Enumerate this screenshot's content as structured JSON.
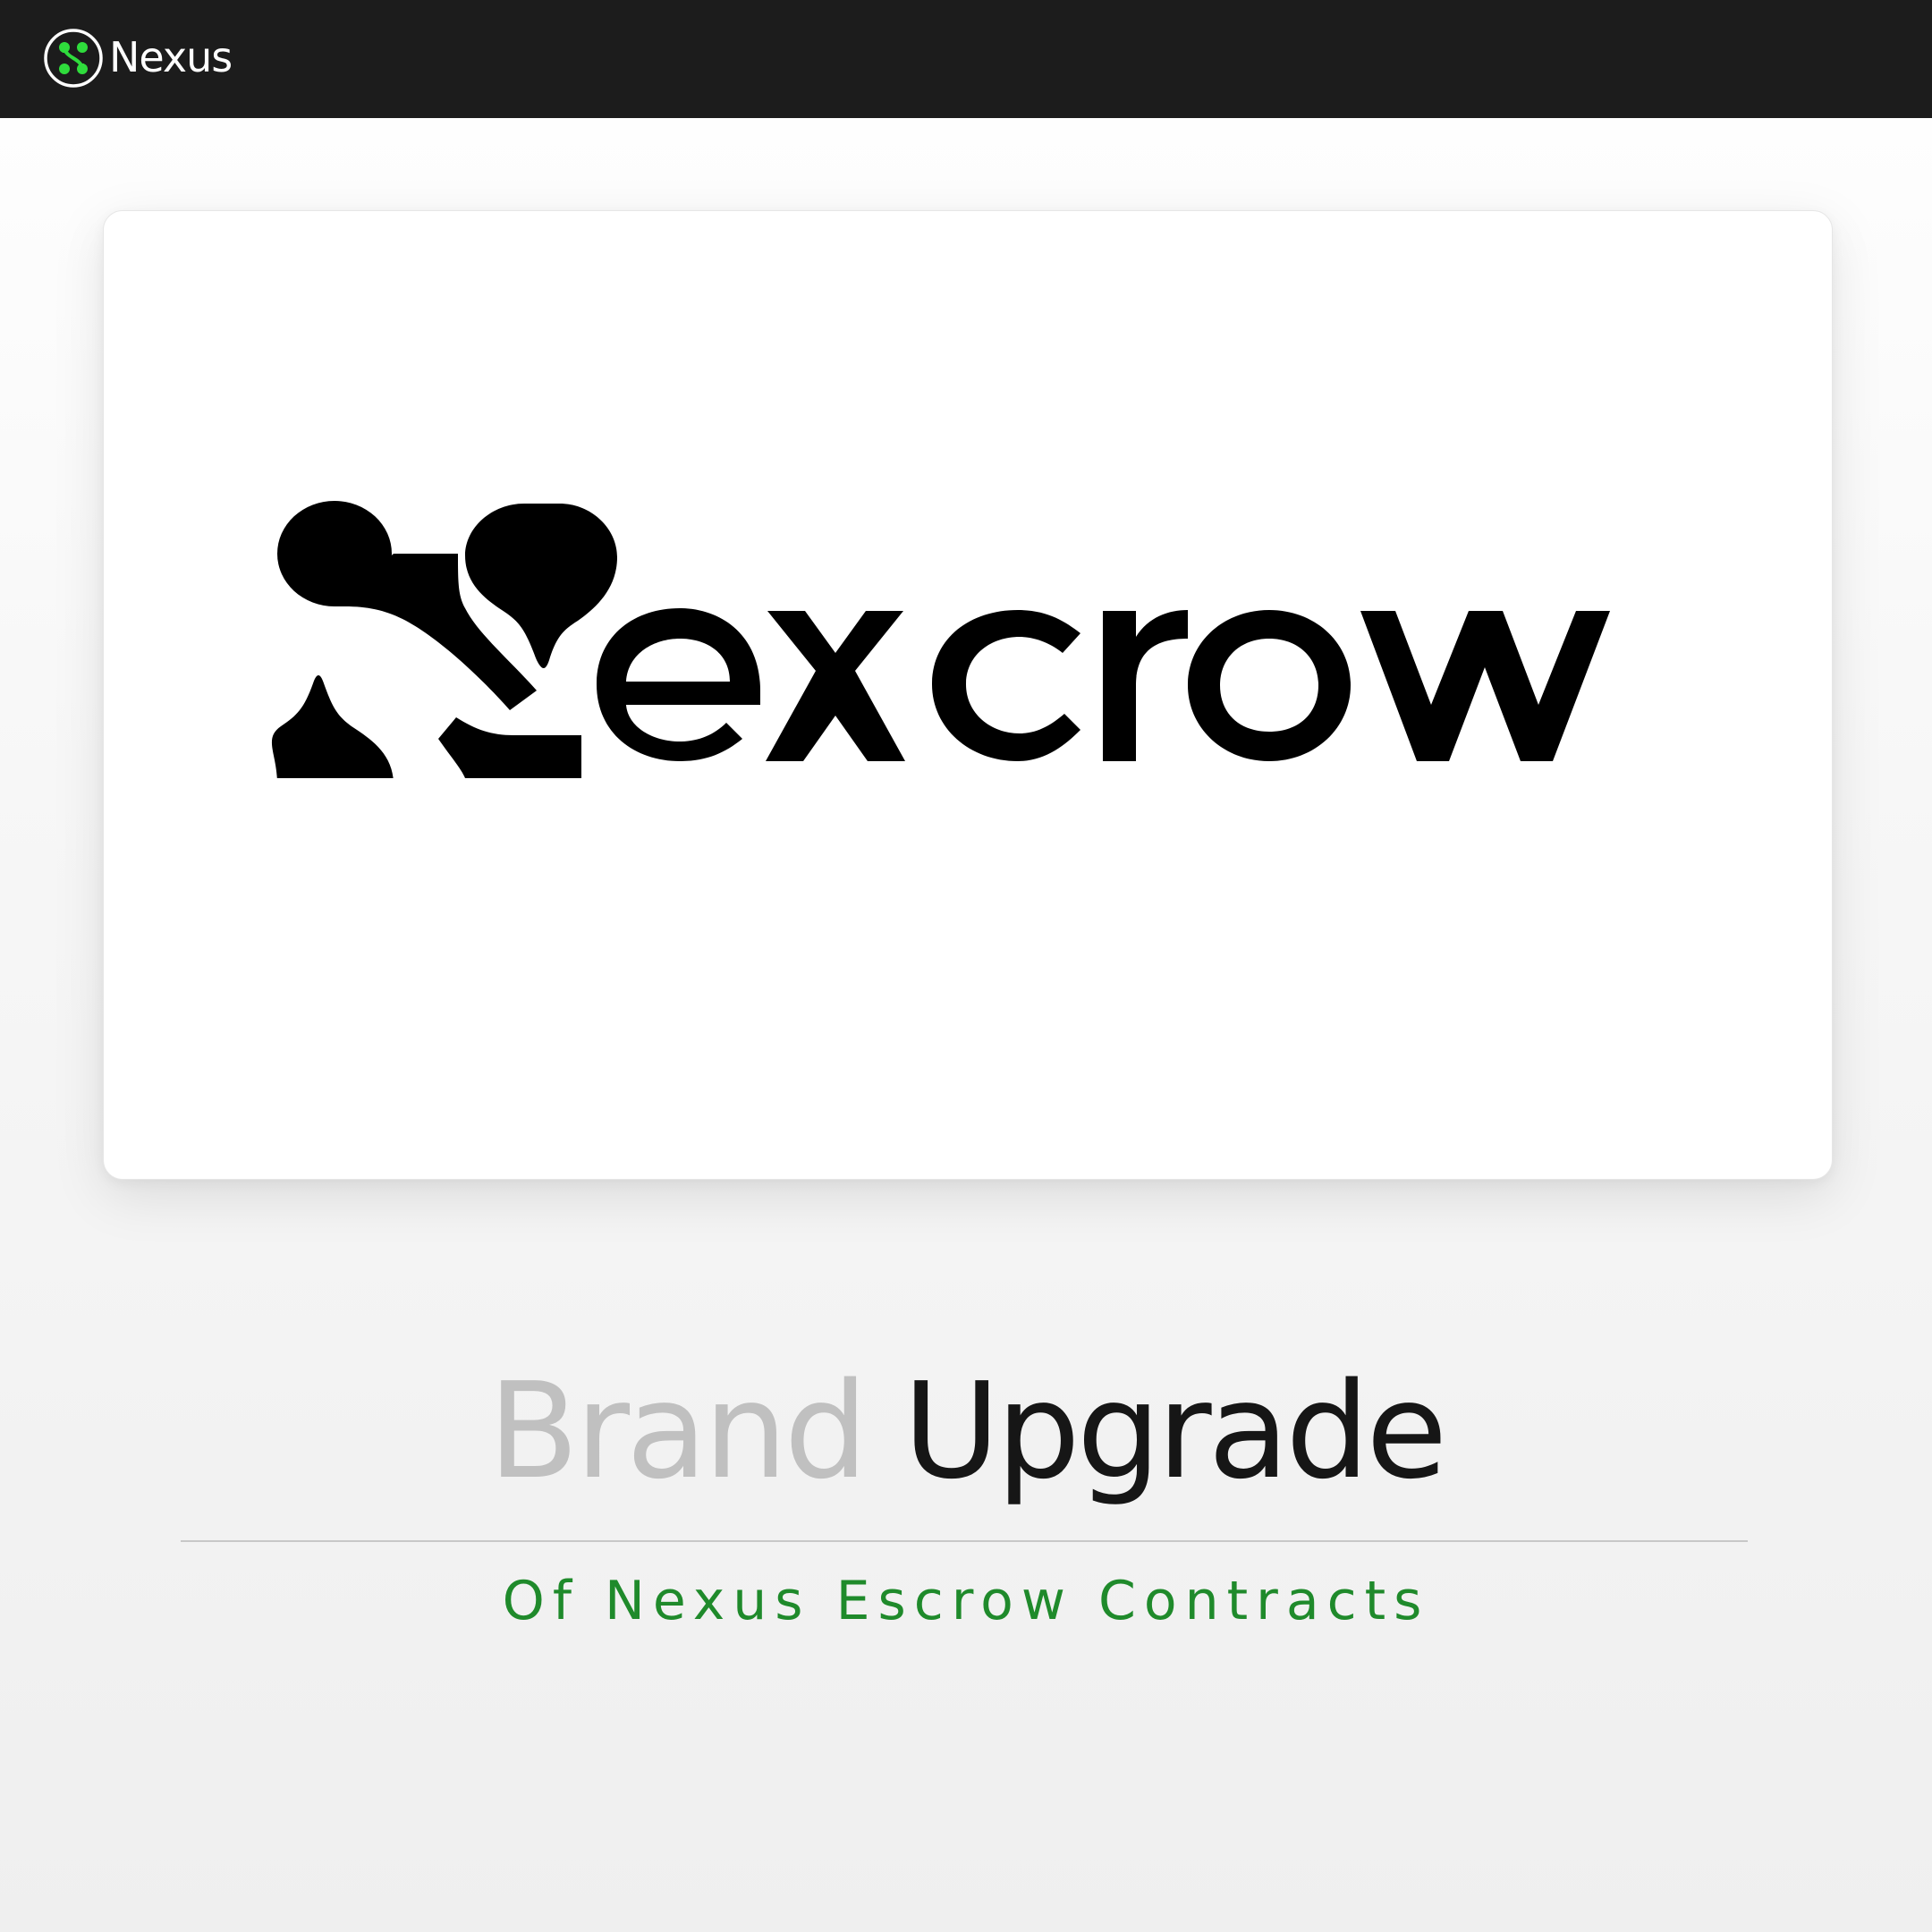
{
  "header": {
    "brand_name": "Nexus",
    "logo_icon": "nexus-logo-icon",
    "background_color": "#1c1c1c",
    "accent_color": "#2fdc3c"
  },
  "card": {
    "wordmark": "Nexcrow",
    "logo_icon": "nexcrow-droplet-n-logo"
  },
  "headline": {
    "word1": "Brand",
    "word2": "Upgrade"
  },
  "subline": {
    "text": "Of Nexus Escrow Contracts",
    "color": "#1f8a2b"
  }
}
